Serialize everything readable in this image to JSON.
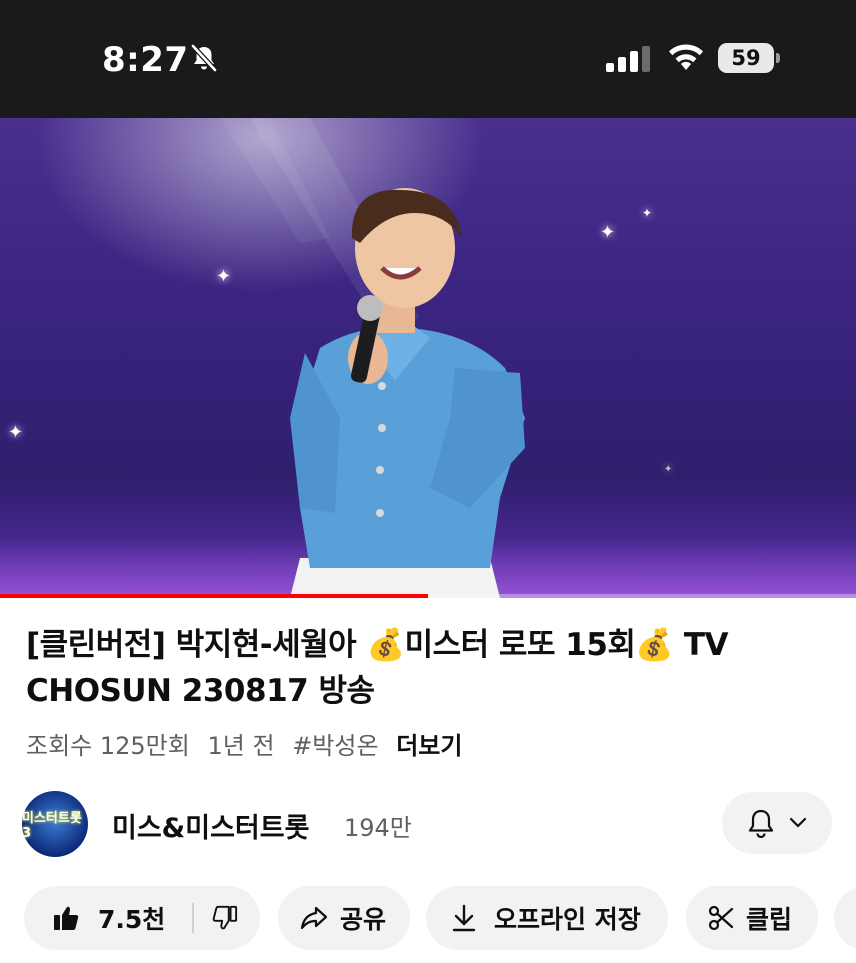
{
  "status_bar": {
    "time": "8:27",
    "battery": "59"
  },
  "video": {
    "progress_fraction": 0.5
  },
  "title": "[클린버전] 박지현-세월아 💰미스터 로또 15회💰 TV CHOSUN 230817 방송",
  "meta": {
    "views": "조회수 125만회",
    "age": "1년 전",
    "hashtag": "#박성온",
    "more": "더보기"
  },
  "channel": {
    "avatar_text": "미스터트롯3",
    "name": "미스&미스터트롯",
    "subscribers": "194만"
  },
  "actions": {
    "like_count": "7.5천",
    "share": "공유",
    "offline_save": "오프라인 저장",
    "clip": "클립"
  },
  "colors": {
    "progress": "#ff0000",
    "pill_bg": "#f2f2f2"
  }
}
